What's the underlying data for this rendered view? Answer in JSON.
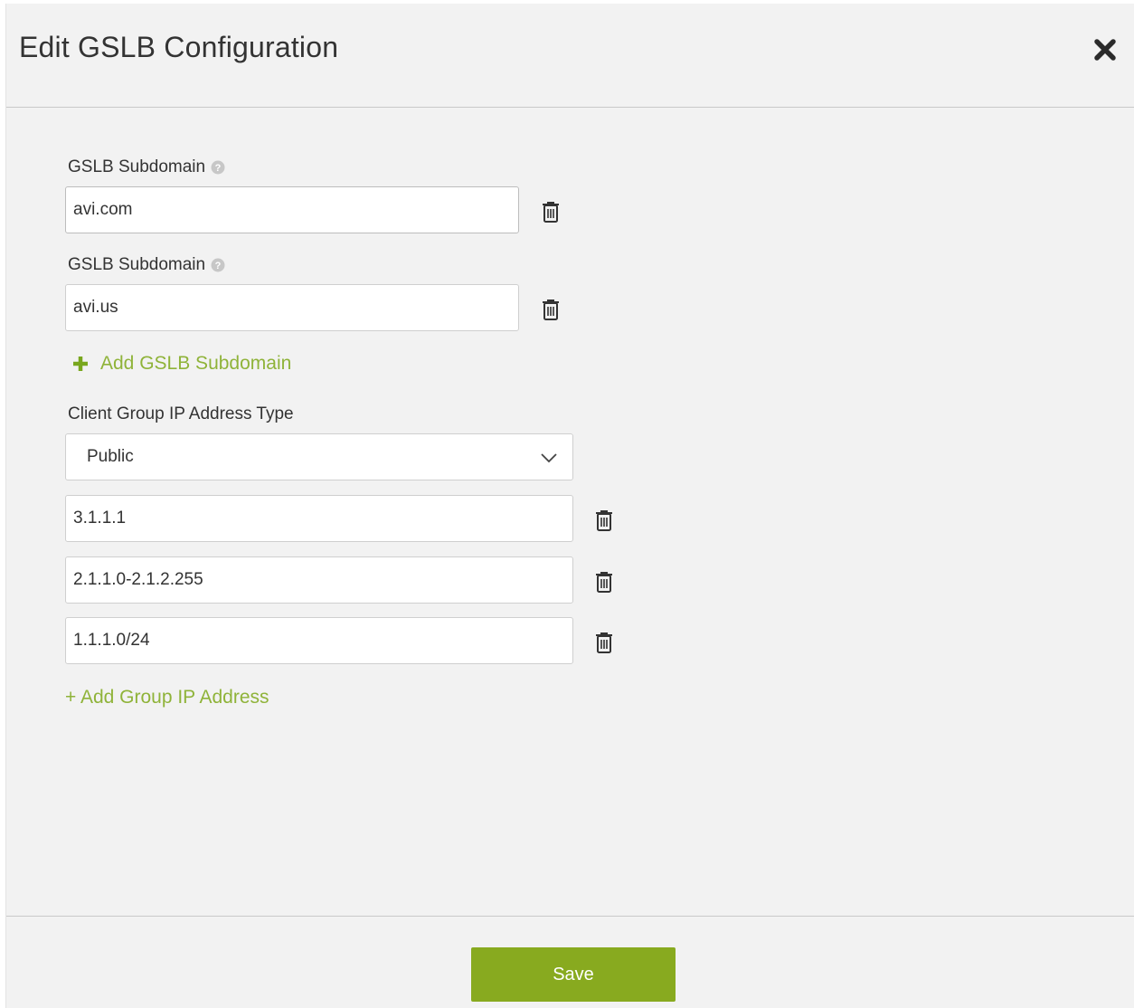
{
  "modal": {
    "title": "Edit GSLB Configuration",
    "close_icon": "close-x-icon"
  },
  "subdomains": [
    {
      "label": "GSLB Subdomain",
      "value": "avi.com"
    },
    {
      "label": "GSLB Subdomain",
      "value": "avi.us"
    }
  ],
  "add_subdomain_label": "Add GSLB Subdomain",
  "client_group": {
    "label": "Client Group IP Address Type",
    "selected": "Public",
    "addresses": [
      "3.1.1.1",
      "2.1.1.0-2.1.2.255",
      "1.1.1.0/24"
    ],
    "add_label": "+ Add Group IP Address"
  },
  "footer": {
    "save_label": "Save"
  },
  "colors": {
    "accent_green": "#88aa1f",
    "link_green": "#8fb339",
    "background": "#f2f2f2"
  }
}
